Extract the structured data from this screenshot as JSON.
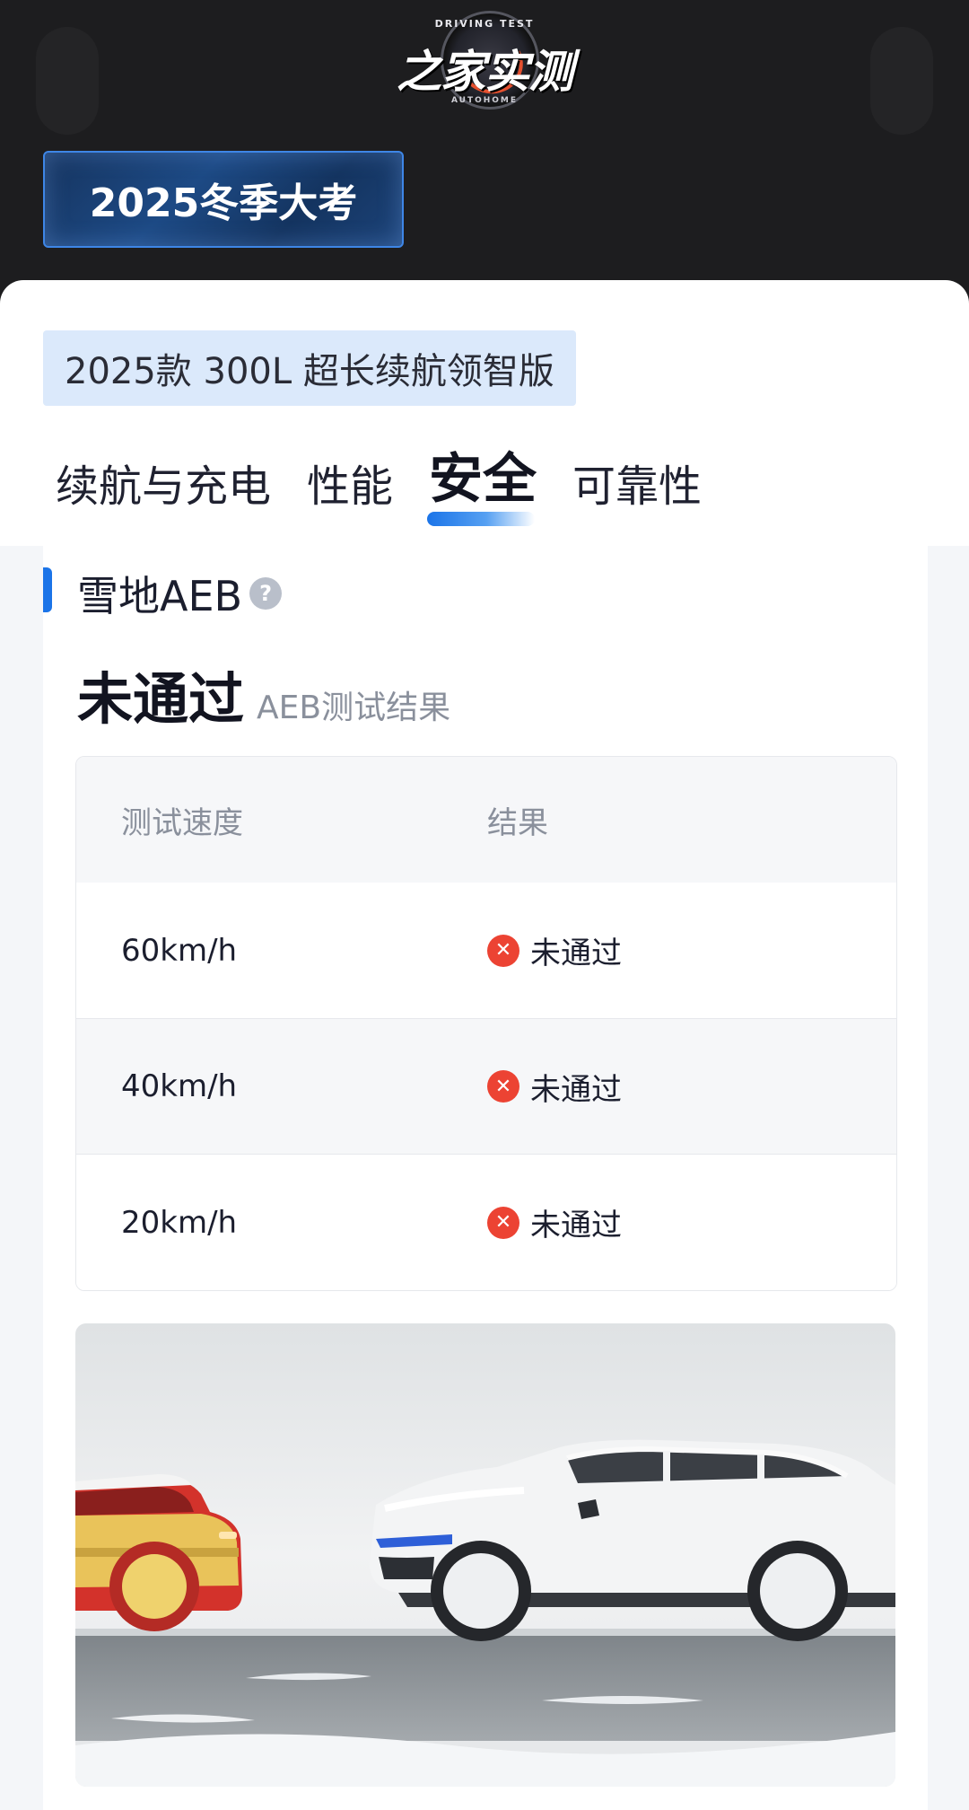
{
  "header": {
    "logo_text": "之家实测",
    "logo_top": "DRIVING TEST",
    "logo_bottom": "AUTOHOME",
    "season_label": "2025冬季大考"
  },
  "model_tag": "2025款 300L 超长续航领智版",
  "tabs": [
    {
      "label": "续航与充电",
      "active": false
    },
    {
      "label": "性能",
      "active": false
    },
    {
      "label": "安全",
      "active": true
    },
    {
      "label": "可靠性",
      "active": false
    }
  ],
  "section": {
    "title": "雪地AEB",
    "help_icon": "question-icon",
    "result": "未通过",
    "result_caption": "AEB测试结果"
  },
  "table": {
    "headers": [
      "测试速度",
      "结果"
    ],
    "rows": [
      {
        "speed": "60km/h",
        "result": "未通过"
      },
      {
        "speed": "40km/h",
        "result": "未通过"
      },
      {
        "speed": "20km/h",
        "result": "未通过"
      }
    ]
  },
  "colors": {
    "accent": "#1b74e8",
    "fail": "#ec4333",
    "header_bg": "#1d1d1f"
  }
}
